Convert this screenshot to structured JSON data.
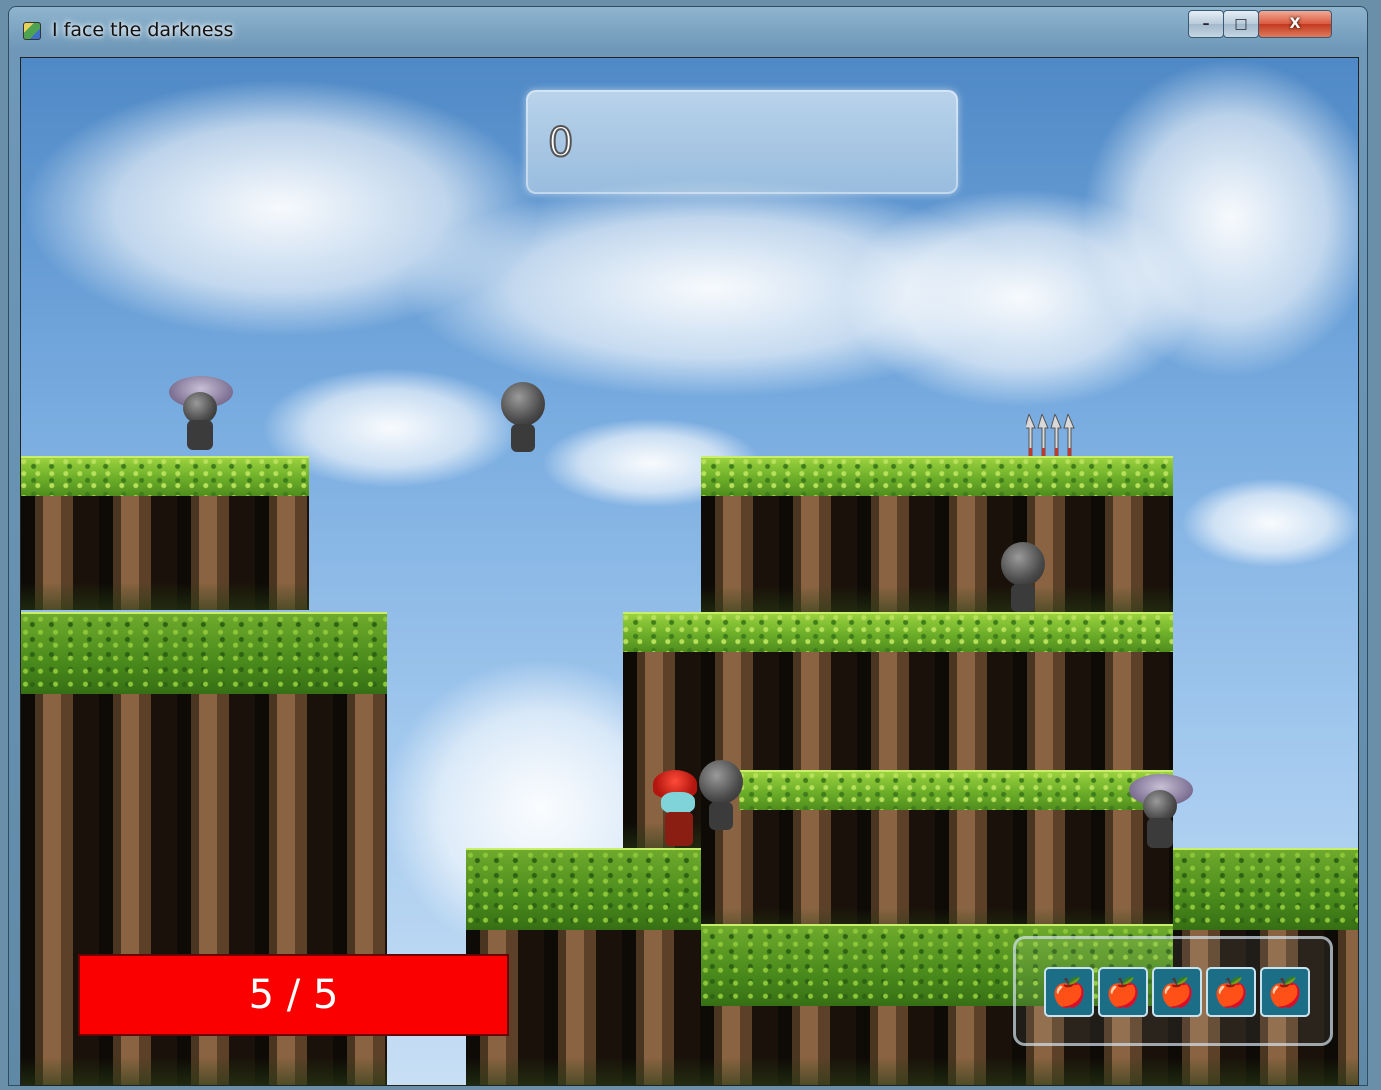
{
  "window": {
    "title": "I face the darkness",
    "controls": {
      "minimize": "–",
      "maximize": "□",
      "close": "X"
    }
  },
  "hud": {
    "score": "0",
    "health": "5 / 5",
    "inventory": {
      "slots": [
        {
          "icon": "apple-icon",
          "glyph": "🍎"
        },
        {
          "icon": "apple-icon",
          "glyph": "🍎"
        },
        {
          "icon": "apple-icon",
          "glyph": "🍎"
        },
        {
          "icon": "apple-icon",
          "glyph": "🍎"
        },
        {
          "icon": "apple-icon",
          "glyph": "🍎"
        }
      ]
    }
  },
  "colors": {
    "health_bar": "#fb0000",
    "inventory_slot": "#1c6d86",
    "grass": "#6fb02a",
    "sky": "#79ace0"
  }
}
